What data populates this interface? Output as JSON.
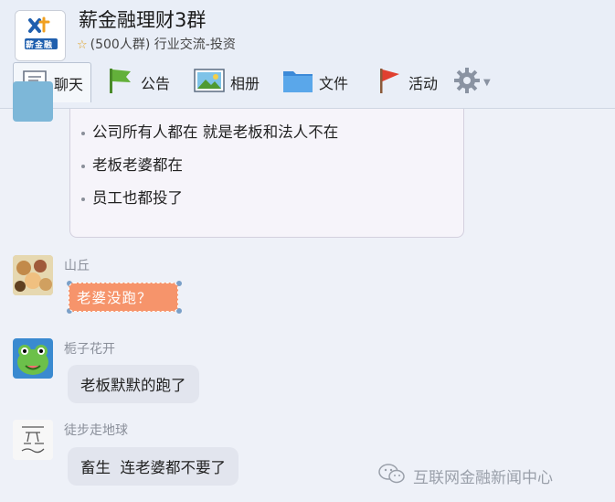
{
  "group": {
    "name": "薪金融理财3群",
    "members": "(500人群)",
    "category": "行业交流-投资",
    "logo_text": "薪金融"
  },
  "tabs": [
    {
      "label": "聊天",
      "icon": "chat-bubble-icon"
    },
    {
      "label": "公告",
      "icon": "flag-icon"
    },
    {
      "label": "相册",
      "icon": "photo-icon"
    },
    {
      "label": "文件",
      "icon": "folder-icon"
    },
    {
      "label": "活动",
      "icon": "pennant-icon"
    },
    {
      "label": "",
      "icon": "gear-icon"
    }
  ],
  "messages": {
    "first_bubble_lines": [
      "公司所有人都在 就是老板和法人不在",
      "老板老婆都在",
      "员工也都投了"
    ],
    "m2": {
      "sender": "山丘",
      "text": "老婆没跑？"
    },
    "m3": {
      "sender": "栀子花开",
      "text": "老板默默的跑了"
    },
    "m4": {
      "sender": "徒步走地球",
      "text": "畜生  连老婆都不要了"
    }
  },
  "watermark": "互联网金融新闻中心",
  "colors": {
    "header_bg": "#e9eef7",
    "chat_bg": "#eef1f8",
    "bubble_bg": "#e2e5ee",
    "orange_bubble": "#f6946b"
  }
}
